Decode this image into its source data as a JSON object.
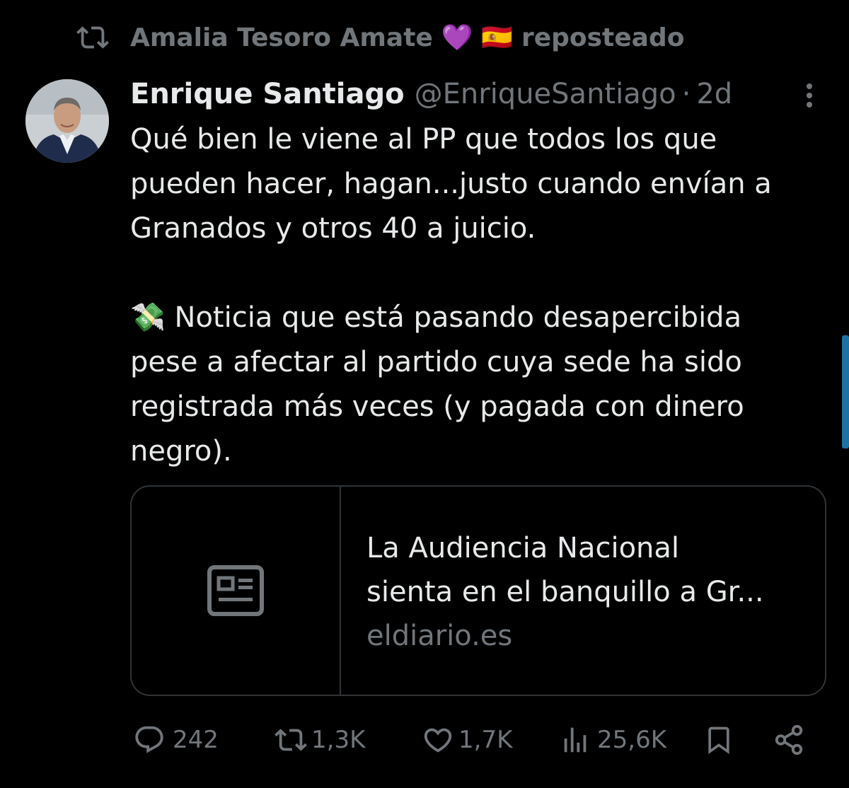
{
  "repost": {
    "icon": "repost-icon",
    "user": "Amalia Tesoro Amate",
    "emojis": "💜 🇪🇸",
    "label": "reposteado"
  },
  "tweet": {
    "author_name": "Enrique Santiago",
    "author_handle": "@EnriqueSantiago",
    "separator": "·",
    "time": "2d",
    "paragraph1": "Qué bien le viene al PP que todos los que\npueden hacer, hagan...justo cuando envían a\nGranados y otros 40 a juicio.",
    "paragraph2": "💸 Noticia que está pasando desapercibida\npese a afectar al partido cuya sede ha sido\nregistrada más veces (y pagada con dinero\nnegro)."
  },
  "card": {
    "icon": "newspaper-icon",
    "title": "La Audiencia Nacional\nsienta en el banquillo a Gr...",
    "domain": "eldiario.es"
  },
  "actions": {
    "replies": "242",
    "reposts": "1,3K",
    "likes": "1,7K",
    "views": "25,6K"
  },
  "colors": {
    "background": "#000000",
    "text": "#e7e9ea",
    "secondary": "#71767b",
    "border": "#2f3336",
    "scroll": "#1d6fa5"
  }
}
